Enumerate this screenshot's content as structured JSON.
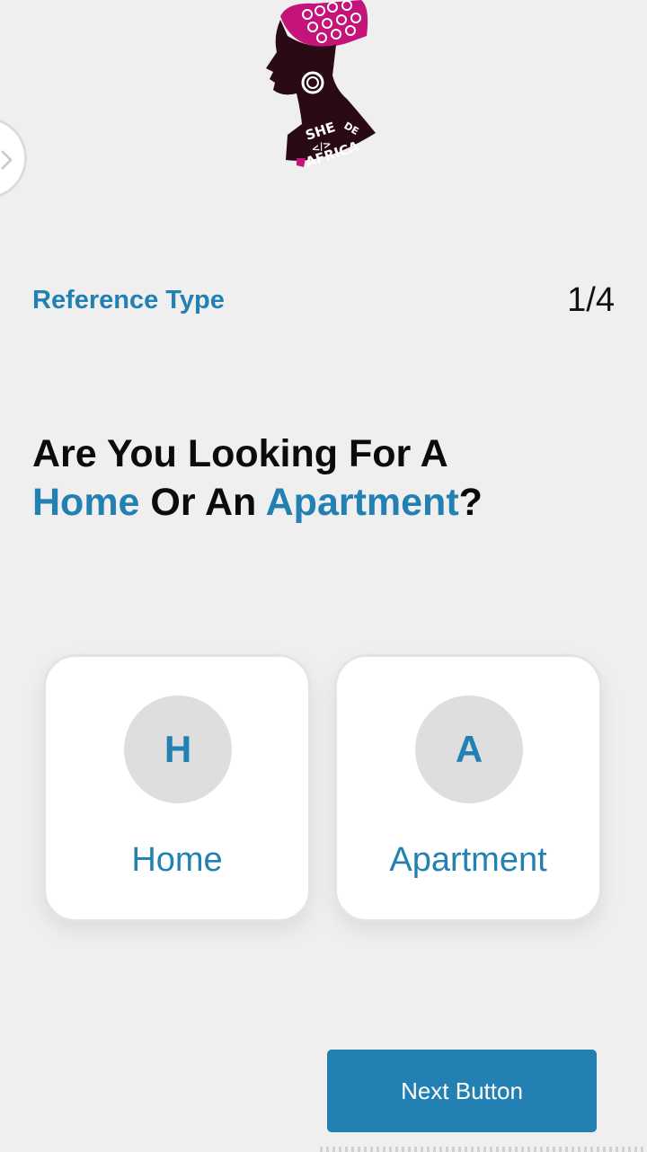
{
  "logo": {
    "text_line1": "SHE",
    "text_line2": "</>",
    "text_line3": "AFRICA",
    "text_arc": "DE"
  },
  "drawer": {
    "icon": "chevron-right-icon"
  },
  "step": {
    "label": "Reference Type",
    "counter": "1/4"
  },
  "question": {
    "line1": "Are You Looking For A",
    "home_word": "Home",
    "connector": " Or An ",
    "apartment_word": "Apartment",
    "end": "?"
  },
  "options": [
    {
      "letter": "H",
      "label": "Home"
    },
    {
      "letter": "A",
      "label": "Apartment"
    }
  ],
  "next_button": {
    "label": "Next Button"
  },
  "colors": {
    "accent": "#2280b3",
    "background": "#efefef",
    "circle": "#dedede",
    "logo_pink": "#c4147a"
  }
}
